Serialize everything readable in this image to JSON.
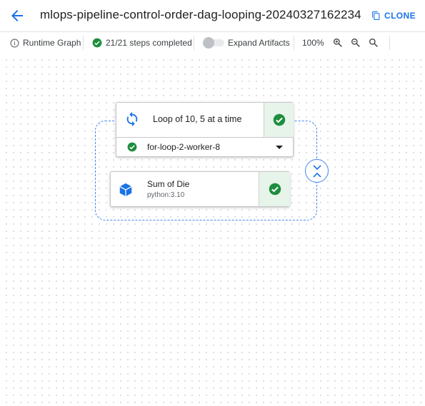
{
  "header": {
    "title": "mlops-pipeline-control-order-dag-looping-20240327162234",
    "clone_label": "CLONE"
  },
  "toolbar": {
    "runtime_graph_label": "Runtime Graph",
    "steps_label": "21/21 steps completed",
    "expand_artifacts_label": "Expand Artifacts",
    "expand_artifacts_enabled": false,
    "zoom_level": "100%"
  },
  "graph": {
    "loop_node": {
      "label": "Loop of 10, 5 at a time",
      "status": "succeeded",
      "selected_iteration": "for-loop-2-worker-8",
      "iteration_status": "succeeded"
    },
    "task_node": {
      "name": "Sum of Die",
      "subtitle": "python:3.10",
      "status": "succeeded"
    }
  },
  "colors": {
    "accent": "#1a73e8",
    "success": "#1e8e3e",
    "success_bg": "#e6f4ea",
    "loop_border": "#4285f4"
  }
}
